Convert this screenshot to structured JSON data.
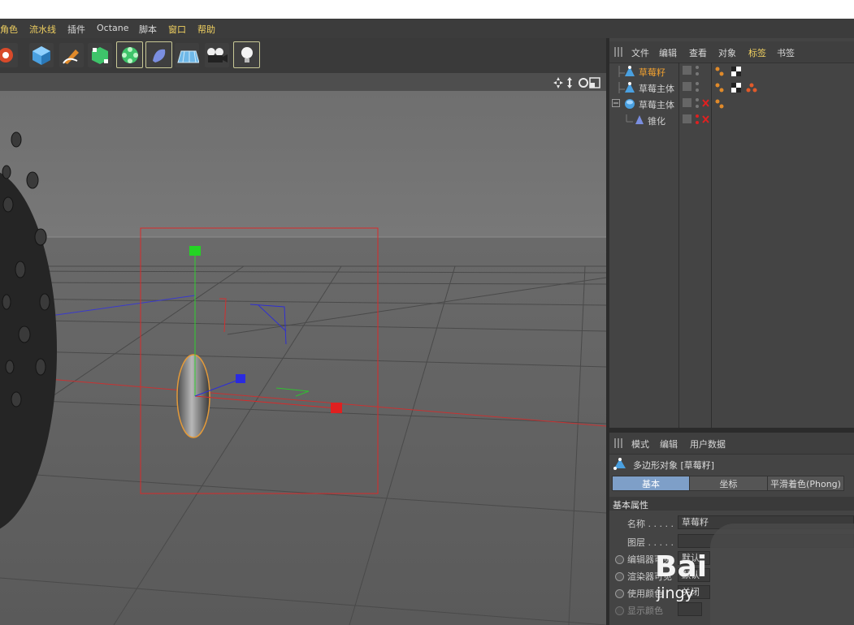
{
  "menu": {
    "items": [
      {
        "label": "角色",
        "highlight": true
      },
      {
        "label": "流水线",
        "highlight": true
      },
      {
        "label": "插件",
        "highlight": false
      },
      {
        "label": "Octane",
        "highlight": false
      },
      {
        "label": "脚本",
        "highlight": false
      },
      {
        "label": "窗口",
        "highlight": true
      },
      {
        "label": "帮助",
        "highlight": true
      }
    ]
  },
  "toolbar": {
    "tools": [
      "gear-tool-icon",
      "cube-icon",
      "pen-icon",
      "subdivision-icon",
      "cloner-icon",
      "deformer-icon",
      "floor-icon",
      "camera-icon",
      "light-icon"
    ]
  },
  "object_manager": {
    "menu": [
      "文件",
      "编辑",
      "查看",
      "对象",
      "标签",
      "书签"
    ],
    "active_menu": "标签",
    "objects": [
      {
        "name": "草莓籽",
        "active": true,
        "indent": 1
      },
      {
        "name": "草莓主体",
        "active": false,
        "indent": 1
      },
      {
        "name": "草莓主体",
        "active": false,
        "indent": 0
      },
      {
        "name": "锥化",
        "active": false,
        "indent": 2
      }
    ]
  },
  "attribute_manager": {
    "menu": [
      "模式",
      "编辑",
      "用户数据"
    ],
    "object_title": "多边形对象 [草莓籽]",
    "tabs": [
      "基本",
      "坐标",
      "平滑着色(Phong)"
    ],
    "active_tab": "基本",
    "section_title": "基本属性",
    "properties": [
      {
        "label": "名称 . . . . .",
        "value": "草莓籽"
      },
      {
        "label": "图层 . . . . .",
        "value": ""
      },
      {
        "label": "编辑器可见",
        "value": "默认"
      },
      {
        "label": "渲染器可见",
        "value": "默认"
      },
      {
        "label": "使用颜色",
        "value": "关闭"
      },
      {
        "label": "显示颜色",
        "value": ""
      }
    ]
  },
  "watermark": {
    "brand": "Bai",
    "sub": "jingy"
  },
  "colors": {
    "accent_yellow": "#f0d060",
    "active_orange": "#f0a030",
    "tab_blue": "#7e9fc8",
    "axis_x": "#e02020",
    "axis_y": "#20d020",
    "axis_z": "#2020e0"
  }
}
